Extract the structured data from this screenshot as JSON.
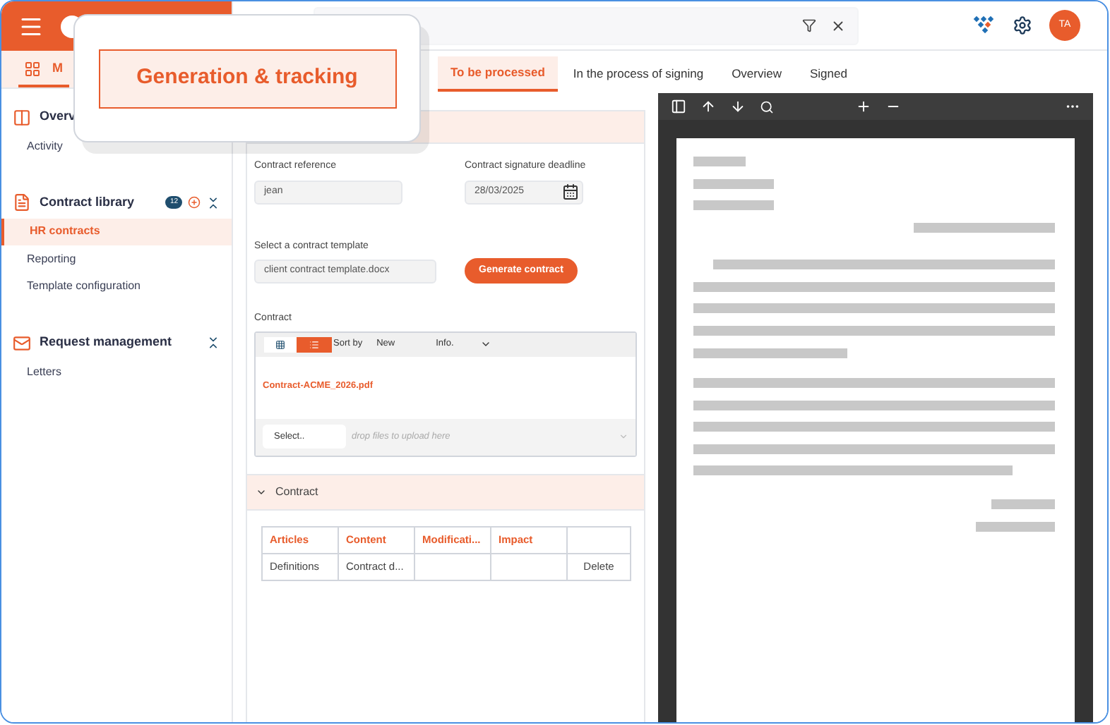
{
  "callout": {
    "label": "Generation & tracking"
  },
  "sidebar": {
    "tab": {
      "label": "M",
      "selected": true
    },
    "sections": [
      {
        "kind": "overview",
        "title": "Overv",
        "items": [
          {
            "label": "Activity",
            "selected": false
          }
        ]
      },
      {
        "kind": "library",
        "title": "Contract library",
        "badge": "12",
        "items": [
          {
            "label": "HR contracts",
            "selected": true
          },
          {
            "label": "Reporting",
            "selected": false
          },
          {
            "label": "Template configuration",
            "selected": false
          }
        ]
      },
      {
        "kind": "mail",
        "title": "Request management",
        "items": [
          {
            "label": "Letters",
            "selected": false
          }
        ]
      }
    ]
  },
  "header": {
    "avatar": "TA"
  },
  "tabs": [
    {
      "label": "To be processed",
      "selected": true
    },
    {
      "label": "In the process of signing",
      "selected": false
    },
    {
      "label": "Overview",
      "selected": false
    },
    {
      "label": "Signed",
      "selected": false
    }
  ],
  "form": {
    "reference": {
      "label": "Contract reference",
      "value": "jean"
    },
    "deadline": {
      "label": "Contract signature deadline",
      "value": "28/03/2025"
    },
    "template": {
      "label": "Select a contract template",
      "value": "client contract template.docx"
    },
    "generate": "Generate contract",
    "upload": {
      "label": "Contract",
      "sort": "Sort by",
      "new": "New",
      "info": "Info.",
      "file": "Contract-ACME_2026.pdf",
      "select": "Select..",
      "placeholder": "drop files to upload here"
    }
  },
  "contract_section": {
    "title": "Contract",
    "expanded": true,
    "columns": [
      "Articles",
      "Content",
      "Modificati...",
      "Impact"
    ],
    "rows": [
      {
        "cells": [
          "Definitions",
          "Contract d...",
          "",
          ""
        ],
        "action": "Delete"
      }
    ]
  }
}
